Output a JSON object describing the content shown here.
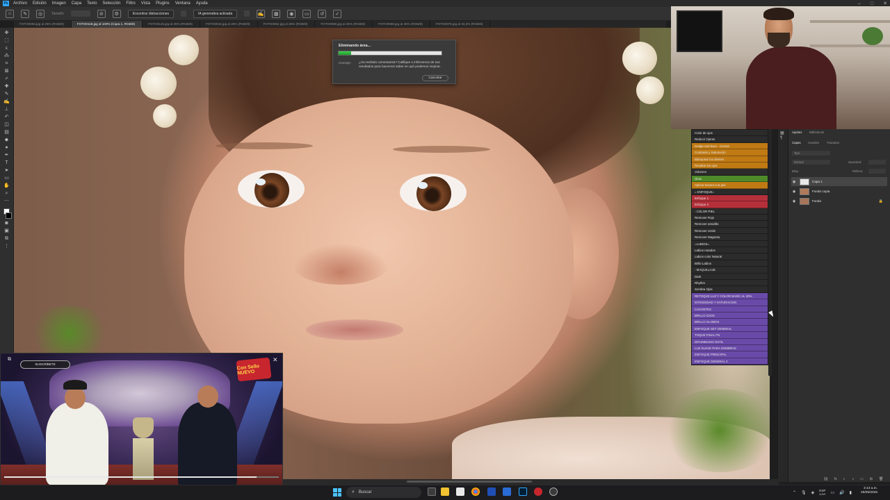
{
  "menubar": {
    "items": [
      "Archivo",
      "Edición",
      "Imagen",
      "Capa",
      "Texto",
      "Selección",
      "Filtro",
      "Vista",
      "Plugins",
      "Ventana",
      "Ayuda"
    ]
  },
  "options": {
    "size_label": "Tamaño",
    "distraction_button": "Encontrar distracciones",
    "ai_button": "IA generativa activada"
  },
  "tabs": [
    "FOTO0093.jpg al 25% (RGB/8)",
    "FOTO0118.jpg al 100% (Capa 1, RGB/8)",
    "FOTO0125.jpg al 25% (RGB/8)",
    "FOTO0044.jpg al 25% (RGB/8)",
    "FOTO0062.jpg al 25% (RGB/8)",
    "FOTO0080.jpg al 25% (RGB/8)",
    "FOTO0089.jpg al 25% (RGB/8)",
    "FOTO0078.jpg al 33,3% (RGB/8)"
  ],
  "dialog": {
    "title": "Eliminando área...",
    "progress": 0.12,
    "tip_label": "Consejo:",
    "tip_text": "¿Ha recibido comentarios? Califique o infórmenos de sus resultados para hacernos saber en qué podemos mejorar.",
    "cancel": "Cancelar"
  },
  "actions": [
    {
      "label": "Color de ojos",
      "color": "#2b2b2b"
    },
    {
      "label": "Reducir Ojeras",
      "color": "#2b2b2b"
    },
    {
      "label": "Dodge and Burn · Curvas",
      "color": "#c07a14"
    },
    {
      "label": "Contraste y Saturación",
      "color": "#c07a14"
    },
    {
      "label": "Blanquear los dientes",
      "color": "#c07a14"
    },
    {
      "label": "Resaltar los ojos",
      "color": "#c07a14"
    },
    {
      "label": "Volumen",
      "color": "#2b2b2b"
    },
    {
      "label": "Glow",
      "color": "#4f8a2a"
    },
    {
      "label": "Aplicar textura a la piel",
      "color": "#c07a14"
    },
    {
      "label": "= ENFOQUE=",
      "color": "#2b2b2b"
    },
    {
      "label": "Enfoque 1",
      "color": "#b5303a"
    },
    {
      "label": "Enfoque 2",
      "color": "#b5303a"
    },
    {
      "label": "- COLOR PIEL",
      "color": "#2b2b2b"
    },
    {
      "label": "Remover Rojo",
      "color": "#2b2b2b"
    },
    {
      "label": "Remover amarillo",
      "color": "#2b2b2b"
    },
    {
      "label": "Remover verde",
      "color": "#2b2b2b"
    },
    {
      "label": "Remover Magenta",
      "color": "#2b2b2b"
    },
    {
      "label": "=LABIOS=",
      "color": "#2b2b2b"
    },
    {
      "label": "Labios rosados",
      "color": "#2b2b2b"
    },
    {
      "label": "Labios color Natural",
      "color": "#2b2b2b"
    },
    {
      "label": "Brillo Labios",
      "color": "#2b2b2b"
    },
    {
      "label": "- MAQUILLAJE",
      "color": "#2b2b2b"
    },
    {
      "label": "Dark",
      "color": "#2b2b2b"
    },
    {
      "label": "Rhythm",
      "color": "#2b2b2b"
    },
    {
      "label": "Sombra Ojos",
      "color": "#2b2b2b"
    },
    {
      "label": "RETOQUE LUZ Y COLOR BASIC AL 30%",
      "color": "#6a4aa8"
    },
    {
      "label": "INTENSIDAD Y SATURACION",
      "color": "#6a4aa8"
    },
    {
      "label": "CACHETES",
      "color": "#6a4aa8"
    },
    {
      "label": "BRILLO OJOS",
      "color": "#6a4aa8"
    },
    {
      "label": "BRILLO GLOBOS",
      "color": "#6a4aa8"
    },
    {
      "label": "ENFOQUE SET GENERAL",
      "color": "#6a4aa8"
    },
    {
      "label": "TOQUE FINAL FN",
      "color": "#6a4aa8"
    },
    {
      "label": "DIFUMINADO SUTIL",
      "color": "#6a4aa8"
    },
    {
      "label": "LUZ SUAVE PARA SOMBRAS",
      "color": "#6a4aa8"
    },
    {
      "label": "ENFOQUE PRINCIPAL",
      "color": "#6a4aa8"
    },
    {
      "label": "ENFOQUE GENERAL 2",
      "color": "#6a4aa8"
    }
  ],
  "layers_panel": {
    "top_tabs": [
      "Ajustes",
      "Bibliotecas"
    ],
    "tabs": [
      "Capas",
      "Canales",
      "Trazados"
    ],
    "kind_placeholder": "Tipo",
    "blend_mode": "Normal",
    "opacity_label": "Opacidad:",
    "lock_label": "Bloq.:",
    "fill_label": "Relleno:",
    "layers": [
      {
        "name": "Capa 1",
        "thumb": "#e8e8e8",
        "selected": true,
        "locked": false
      },
      {
        "name": "Fondo copia",
        "thumb": "#b07a5a",
        "selected": false,
        "locked": false
      },
      {
        "name": "Fondo",
        "thumb": "#a8745a",
        "selected": false,
        "locked": true
      }
    ]
  },
  "pip": {
    "badge": "SUSCRÍBETE",
    "logo": "Con Sello NUEVO",
    "progress": 0.92
  },
  "taskbar": {
    "search_label": "Buscar",
    "lang_top": "ESP",
    "lang_bottom": "LAA",
    "time": "3:13 a.m.",
    "date": "25/05/2026"
  },
  "colors": {
    "ps_blue": "#31a8ff",
    "progress_green": "#2fbf3f",
    "win_accent": "#4cc2ff"
  }
}
